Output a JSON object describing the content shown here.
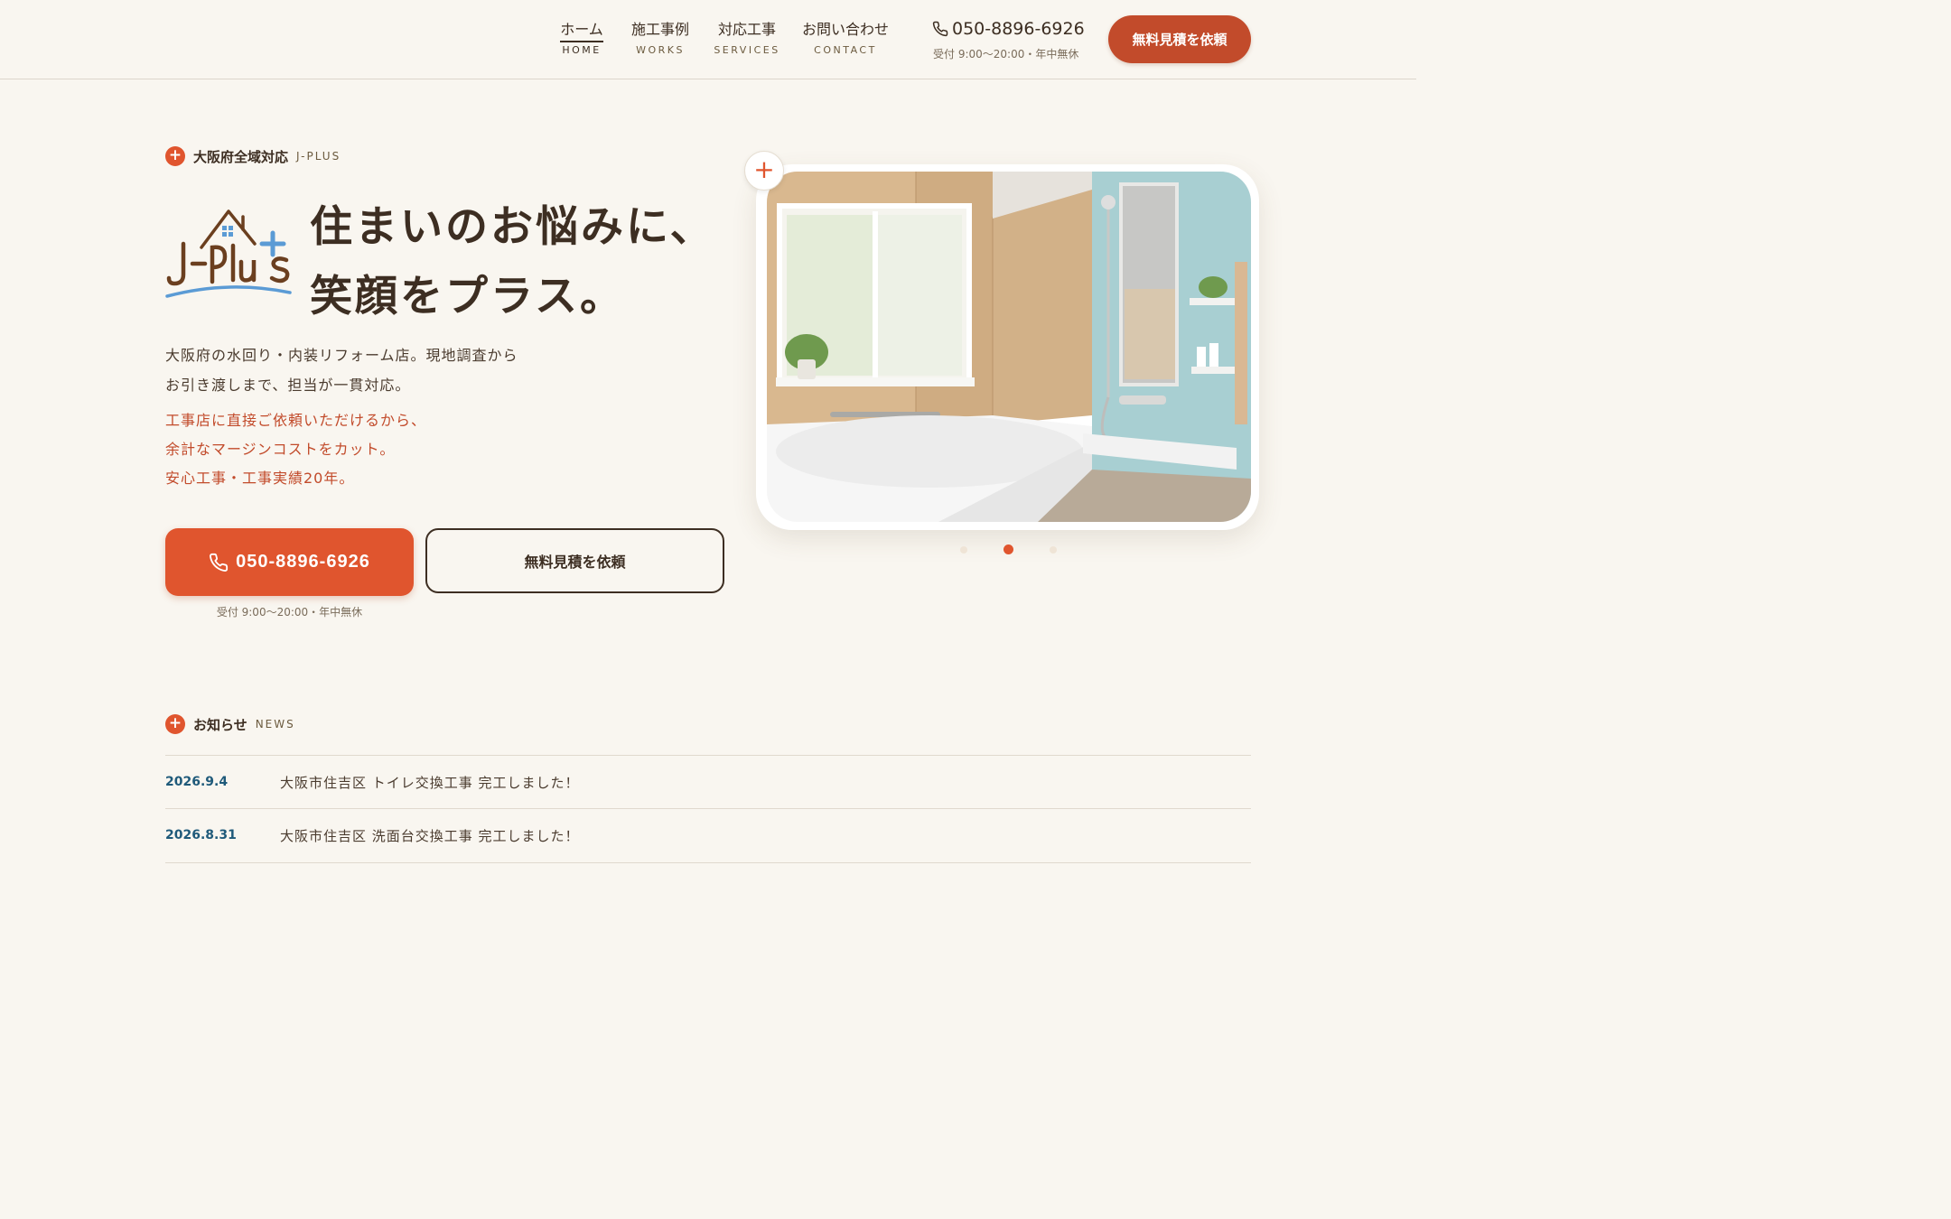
{
  "nav": {
    "items": [
      {
        "jp": "ホーム",
        "en": "HOME"
      },
      {
        "jp": "施工事例",
        "en": "WORKS"
      },
      {
        "jp": "対応工事",
        "en": "SERVICES"
      },
      {
        "jp": "お問い合わせ",
        "en": "CONTACT"
      }
    ],
    "active_index": 0,
    "phone": "050-8896-6926",
    "hours": "受付 9:00〜20:00・年中無休",
    "cta": "無料見積を依頼"
  },
  "hero": {
    "eyebrow_jp": "大阪府全域対応",
    "eyebrow_en": "J-PLUS",
    "logo_text": "J-Plus",
    "headline_line1": "住まいのお悩みに、",
    "headline_line2": "笑顔をプラス。",
    "desc_line1": "大阪府の水回り・内装リフォーム店。現地調査から",
    "desc_line2": "お引き渡しまで、担当が一貫対応。",
    "accent_line1": "工事店に直接ご依頼いただけるから、",
    "accent_line2": "余計なマージンコストをカット。",
    "accent_line3": "安心工事・工事実績20年。",
    "phone_button": "050-8896-6926",
    "phone_hours": "受付 9:00〜20:00・年中無休",
    "quote_button": "無料見積を依頼",
    "plus_symbol": "+",
    "slider_active_index": 1
  },
  "news": {
    "title_jp": "お知らせ",
    "title_en": "NEWS",
    "items": [
      {
        "date": "2026.9.4",
        "text": "大阪市住吉区 トイレ交換工事 完工しました！"
      },
      {
        "date": "2026.8.31",
        "text": "大阪市住吉区 洗面台交換工事 完工しました！"
      }
    ]
  },
  "colors": {
    "background": "#f9f6f0",
    "primary": "#e0552e",
    "primary_dark": "#c24b2b",
    "text": "#3d2e22",
    "news_date": "#1f5a7a",
    "logo_blue": "#5b9bd5"
  },
  "icons": {
    "phone": "phone-icon",
    "plus": "plus-icon"
  }
}
